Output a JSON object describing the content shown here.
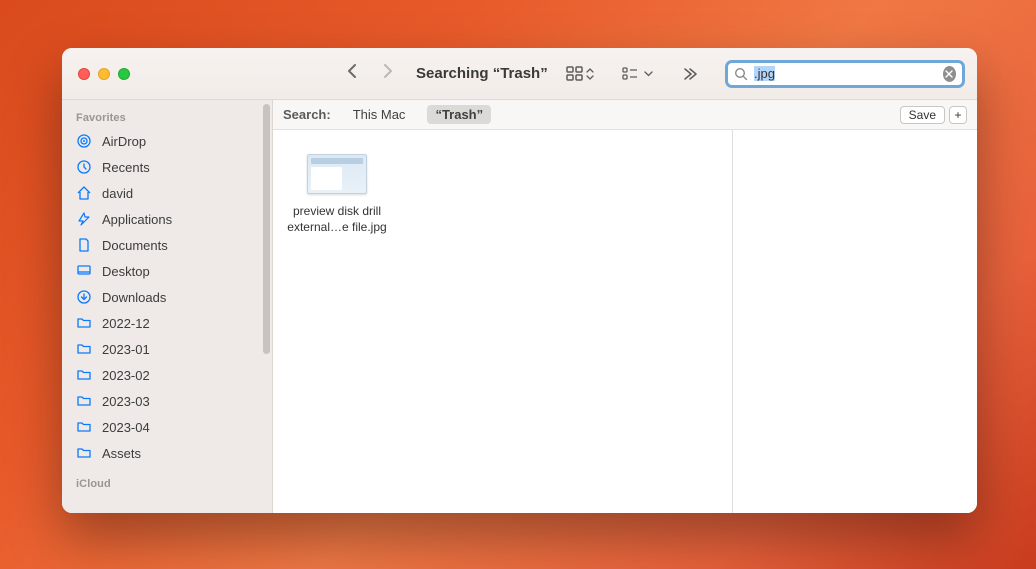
{
  "window": {
    "title": "Searching “Trash”"
  },
  "search": {
    "value": ".jpg"
  },
  "searchbar": {
    "label": "Search:",
    "scopes": [
      "This Mac",
      "“Trash”"
    ],
    "active_scope_index": 1,
    "save_label": "Save"
  },
  "sidebar": {
    "sections": [
      {
        "label": "Favorites",
        "items": [
          {
            "icon": "airdrop",
            "label": "AirDrop"
          },
          {
            "icon": "recents",
            "label": "Recents"
          },
          {
            "icon": "home",
            "label": "david"
          },
          {
            "icon": "apps",
            "label": "Applications"
          },
          {
            "icon": "doc",
            "label": "Documents"
          },
          {
            "icon": "desktop",
            "label": "Desktop"
          },
          {
            "icon": "download",
            "label": "Downloads"
          },
          {
            "icon": "folder",
            "label": "2022-12"
          },
          {
            "icon": "folder",
            "label": "2023-01"
          },
          {
            "icon": "folder",
            "label": "2023-02"
          },
          {
            "icon": "folder",
            "label": "2023-03"
          },
          {
            "icon": "folder",
            "label": "2023-04"
          },
          {
            "icon": "folder",
            "label": "Assets"
          }
        ]
      },
      {
        "label": "iCloud",
        "items": []
      }
    ]
  },
  "results": [
    {
      "name": "preview disk drill\nexternal…e file.jpg"
    }
  ]
}
